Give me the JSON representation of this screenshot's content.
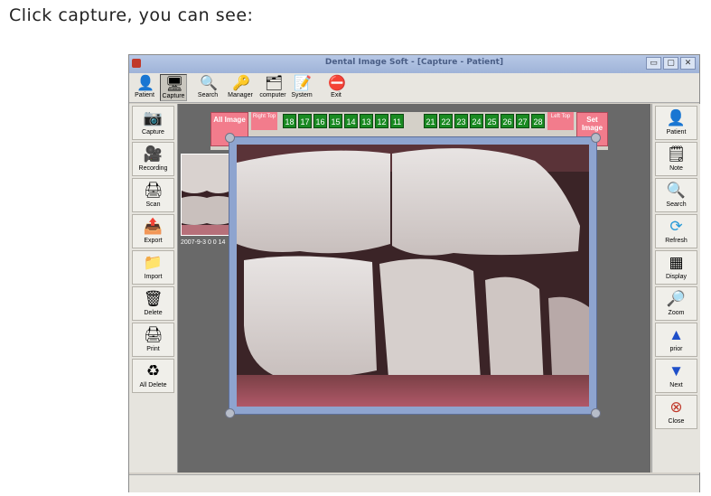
{
  "caption": "Click capture, you can see:",
  "window": {
    "title": "Dental Image Soft - [Capture - Patient]",
    "controls": [
      "▭",
      "▢",
      "✕"
    ]
  },
  "toolbar": [
    {
      "label": "Patient",
      "icon": "patient-icon"
    },
    {
      "label": "Capture",
      "icon": "capture-icon"
    },
    {
      "label": "Search",
      "icon": "search-icon"
    },
    {
      "label": "Manager",
      "icon": "manager-icon"
    },
    {
      "label": "computer",
      "icon": "computer-icon"
    },
    {
      "label": "System",
      "icon": "system-icon"
    },
    {
      "label": "Exit",
      "icon": "exit-icon"
    }
  ],
  "left_panel": [
    {
      "label": "Capture",
      "icon": "camera-icon"
    },
    {
      "label": "Recording",
      "icon": "video-camera-icon"
    },
    {
      "label": "Scan",
      "icon": "scan-icon"
    },
    {
      "label": "Export",
      "icon": "export-icon"
    },
    {
      "label": "Import",
      "icon": "folder-icon"
    },
    {
      "label": "Delete",
      "icon": "trash-icon"
    },
    {
      "label": "Print",
      "icon": "print-icon"
    },
    {
      "label": "All Delete",
      "icon": "recycle-bin-icon"
    }
  ],
  "right_panel": [
    {
      "label": "Patient",
      "icon": "patient-icon"
    },
    {
      "label": "Note",
      "icon": "note-icon"
    },
    {
      "label": "Search",
      "icon": "search-icon"
    },
    {
      "label": "Refresh",
      "icon": "refresh-icon"
    },
    {
      "label": "Display",
      "icon": "display-icon"
    },
    {
      "label": "Zoom",
      "icon": "zoom-icon"
    },
    {
      "label": "prior",
      "icon": "up-arrow-icon"
    },
    {
      "label": "Next",
      "icon": "down-arrow-icon"
    },
    {
      "label": "Close",
      "icon": "close-icon"
    }
  ],
  "teeth_bar": {
    "all_image": "All Image",
    "right_top": "Right Top",
    "left_top": "Left Top",
    "set_image": "Set Image",
    "right_teeth": [
      "18",
      "17",
      "16",
      "15",
      "14",
      "13",
      "12",
      "11"
    ],
    "left_teeth": [
      "21",
      "22",
      "23",
      "24",
      "25",
      "26",
      "27",
      "28"
    ]
  },
  "thumbnail": {
    "date": "2007-9-3 0 0 14"
  },
  "colors": {
    "tooth_green": "#1a8a22",
    "pink": "#f27c8c",
    "viewer_frame": "#8ea4cf"
  }
}
